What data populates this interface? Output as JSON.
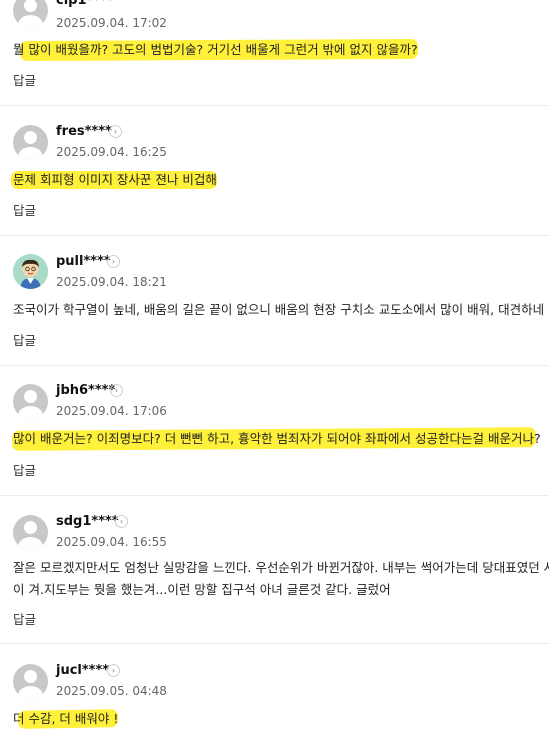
{
  "comments": [
    {
      "nickname": "cip1****",
      "date": "2025.09.04. 17:02",
      "text": "뭘 많이 배웠을까? 고도의 범법기술? 거기선 배울게 그런거 밖에 없지 않을까?",
      "reply": "답글",
      "avatar": "default-avatar"
    },
    {
      "nickname": "fres****",
      "date": "2025.09.04. 16:25",
      "text": "문제 회피형 이미지 장사꾼 젼나 비겁해",
      "reply": "답글",
      "avatar": "default-avatar"
    },
    {
      "nickname": "pull****",
      "date": "2025.09.04. 18:21",
      "text": "조국이가 학구열이 높네, 배움의 길은 끝이 없으니 배움의 현장 구치소 교도소에서 많이 배워, 대견하네",
      "reply": "답글",
      "avatar": "cartoon-avatar"
    },
    {
      "nickname": "jbh6****",
      "date": "2025.09.04. 17:06",
      "text": "많이 배운거는? 이죄명보다? 더 뻔뻔 하고, 흉악한 범죄자가 되어야 좌파에서 성공한다는걸 배운거나?",
      "reply": "답글",
      "avatar": "default-avatar"
    },
    {
      "nickname": "sdg1****",
      "date": "2025.09.04. 16:55",
      "text": "잘은 모르겠지만서도 엄청난 실망감을 느낀다. 우선순위가 바뀐거잖아. 내부는 썩어가는데 당대표였던 사람이 겨.지도부는 뭣을 했는겨...이런 망할 집구석 아녀 글른것 같다. 글렀어",
      "reply": "답글",
      "avatar": "default-avatar"
    },
    {
      "nickname": "jucl****",
      "date": "2025.09.05. 04:48",
      "text": "더 수감, 더 배워야 !",
      "reply": "답글",
      "avatar": "default-avatar"
    }
  ],
  "colors": {
    "highlight": "#ffef2e",
    "divider": "#ececec",
    "avatar_bg": "#c8c8c8"
  },
  "icons": {
    "profile_arrow": "›"
  }
}
